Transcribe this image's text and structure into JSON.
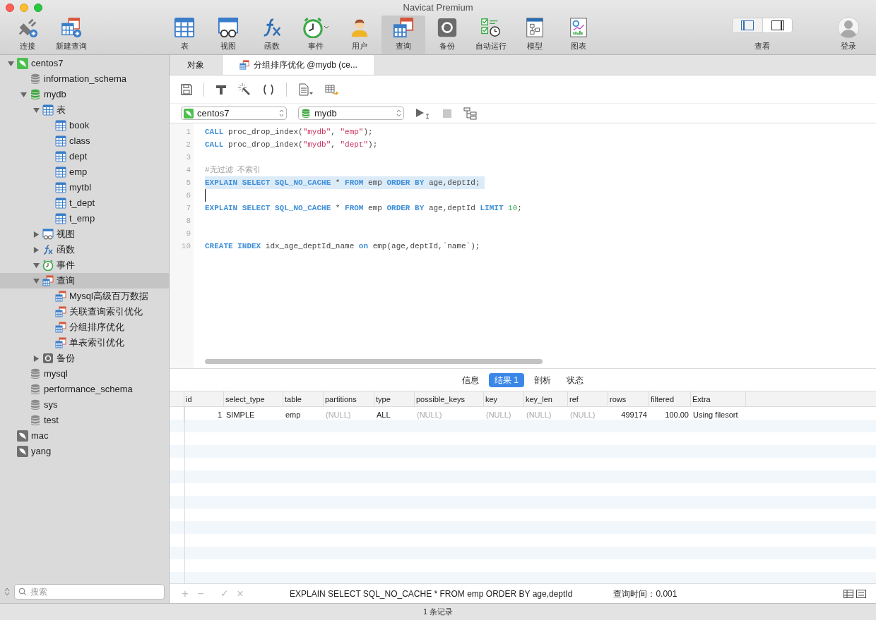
{
  "window": {
    "title": "Navicat Premium"
  },
  "toolbar": {
    "buttons": [
      {
        "label": "连接",
        "kind": "connect",
        "selected": false
      },
      {
        "label": "新建查询",
        "kind": "new_query",
        "selected": false
      },
      {
        "label": "表",
        "kind": "table",
        "selected": false
      },
      {
        "label": "视图",
        "kind": "view",
        "selected": false
      },
      {
        "label": "函数",
        "kind": "function",
        "selected": false
      },
      {
        "label": "事件",
        "kind": "event",
        "selected": false,
        "dropdown": true
      },
      {
        "label": "用户",
        "kind": "user",
        "selected": false
      },
      {
        "label": "查询",
        "kind": "query",
        "selected": true
      },
      {
        "label": "备份",
        "kind": "backup",
        "selected": false
      },
      {
        "label": "自动运行",
        "kind": "schedule",
        "selected": false
      },
      {
        "label": "模型",
        "kind": "model",
        "selected": false
      },
      {
        "label": "图表",
        "kind": "chart",
        "selected": false
      }
    ],
    "view": {
      "label": "查看",
      "toggles": [
        {
          "kind": "left_panel",
          "selected": true
        },
        {
          "kind": "right_panel",
          "selected": false
        }
      ]
    },
    "login": {
      "label": "登录"
    }
  },
  "sidebar": {
    "tree": [
      {
        "label": "centos7",
        "kind": "server",
        "expanded": true,
        "selected": false,
        "children": [
          {
            "label": "information_schema",
            "kind": "database",
            "selected": false
          },
          {
            "label": "mydb",
            "kind": "database_open",
            "expanded": true,
            "selected": false,
            "children": [
              {
                "label": "表",
                "kind": "table",
                "expanded": true,
                "selected": false,
                "children": [
                  {
                    "label": "book",
                    "kind": "table",
                    "selected": false
                  },
                  {
                    "label": "class",
                    "kind": "table",
                    "selected": false
                  },
                  {
                    "label": "dept",
                    "kind": "table",
                    "selected": false
                  },
                  {
                    "label": "emp",
                    "kind": "table",
                    "selected": false
                  },
                  {
                    "label": "mytbl",
                    "kind": "table",
                    "selected": false
                  },
                  {
                    "label": "t_dept",
                    "kind": "table",
                    "selected": false
                  },
                  {
                    "label": "t_emp",
                    "kind": "table",
                    "selected": false
                  }
                ]
              },
              {
                "label": "视图",
                "kind": "view",
                "expanded": false,
                "selected": false
              },
              {
                "label": "函数",
                "kind": "function",
                "expanded": false,
                "selected": false
              },
              {
                "label": "事件",
                "kind": "event",
                "expanded": true,
                "selected": false
              },
              {
                "label": "查询",
                "kind": "query",
                "expanded": true,
                "selected": true,
                "children": [
                  {
                    "label": "Mysql高级百万数据",
                    "kind": "query",
                    "selected": false
                  },
                  {
                    "label": "关联查询索引优化",
                    "kind": "query",
                    "selected": false
                  },
                  {
                    "label": "分组排序优化",
                    "kind": "query",
                    "selected": false
                  },
                  {
                    "label": "单表索引优化",
                    "kind": "query",
                    "selected": false
                  }
                ]
              },
              {
                "label": "备份",
                "kind": "backup",
                "expanded": false,
                "selected": false
              }
            ]
          },
          {
            "label": "mysql",
            "kind": "database",
            "selected": false
          },
          {
            "label": "performance_schema",
            "kind": "database",
            "selected": false
          },
          {
            "label": "sys",
            "kind": "database",
            "selected": false
          },
          {
            "label": "test",
            "kind": "database",
            "selected": false
          }
        ]
      },
      {
        "label": "mac",
        "kind": "server_off",
        "selected": false
      },
      {
        "label": "yang",
        "kind": "server_off",
        "selected": false
      }
    ],
    "search": {
      "placeholder": "搜索"
    }
  },
  "tabs": [
    {
      "label": "对象",
      "selected": false,
      "kind": "objects"
    },
    {
      "label": "分组排序优化 @mydb (ce...",
      "selected": true,
      "kind": "query"
    }
  ],
  "selectors": {
    "connection": "centos7",
    "database": "mydb"
  },
  "editor": {
    "lines": [
      {
        "number": "1",
        "tokens": [
          {
            "kind": "keyword",
            "text": "CALL"
          },
          {
            "kind": "plain",
            "text": " proc_drop_index("
          },
          {
            "kind": "string",
            "text": "\"mydb\""
          },
          {
            "kind": "plain",
            "text": ", "
          },
          {
            "kind": "string",
            "text": "\"emp\""
          },
          {
            "kind": "plain",
            "text": ");"
          }
        ]
      },
      {
        "number": "2",
        "tokens": [
          {
            "kind": "keyword",
            "text": "CALL"
          },
          {
            "kind": "plain",
            "text": " proc_drop_index("
          },
          {
            "kind": "string",
            "text": "\"mydb\""
          },
          {
            "kind": "plain",
            "text": ", "
          },
          {
            "kind": "string",
            "text": "\"dept\""
          },
          {
            "kind": "plain",
            "text": ");"
          }
        ]
      },
      {
        "number": "3"
      },
      {
        "number": "4",
        "tokens": [
          {
            "kind": "comment",
            "text": "#无过滤 不索引"
          }
        ]
      },
      {
        "number": "5",
        "highlighted": true,
        "tokens": [
          {
            "kind": "keyword",
            "text": "EXPLAIN SELECT SQL_NO_CACHE"
          },
          {
            "kind": "plain",
            "text": " * "
          },
          {
            "kind": "keyword",
            "text": "FROM"
          },
          {
            "kind": "plain",
            "text": " emp "
          },
          {
            "kind": "keyword",
            "text": "ORDER BY"
          },
          {
            "kind": "plain",
            "text": " age,deptId;"
          }
        ]
      },
      {
        "number": "6",
        "cursor": true
      },
      {
        "number": "7",
        "tokens": [
          {
            "kind": "keyword",
            "text": "EXPLAIN SELECT SQL_NO_CACHE"
          },
          {
            "kind": "plain",
            "text": " * "
          },
          {
            "kind": "keyword",
            "text": "FROM"
          },
          {
            "kind": "plain",
            "text": " emp "
          },
          {
            "kind": "keyword",
            "text": "ORDER BY"
          },
          {
            "kind": "plain",
            "text": " age,deptId "
          },
          {
            "kind": "keyword",
            "text": "LIMIT"
          },
          {
            "kind": "number",
            "text": " 10"
          },
          {
            "kind": "plain",
            "text": ";"
          }
        ]
      },
      {
        "number": "8"
      },
      {
        "number": "9"
      },
      {
        "number": "10",
        "tokens": [
          {
            "kind": "keyword",
            "text": "CREATE INDEX"
          },
          {
            "kind": "plain",
            "text": " idx_age_deptId_name "
          },
          {
            "kind": "keyword",
            "text": "on"
          },
          {
            "kind": "plain",
            "text": " emp(age,deptId,`name`);"
          }
        ]
      }
    ]
  },
  "result_tabs": [
    {
      "label": "信息",
      "selected": false
    },
    {
      "label": "结果 1",
      "selected": true
    },
    {
      "label": "剖析",
      "selected": false
    },
    {
      "label": "状态",
      "selected": false
    }
  ],
  "table": {
    "columns": [
      "id",
      "select_type",
      "table",
      "partitions",
      "type",
      "possible_keys",
      "key",
      "key_len",
      "ref",
      "rows",
      "filtered",
      "Extra"
    ],
    "rows": [
      [
        {
          "text": "1",
          "kind": "number"
        },
        {
          "text": "SIMPLE",
          "kind": "text"
        },
        {
          "text": "emp",
          "kind": "text"
        },
        {
          "text": "(NULL)",
          "kind": "null"
        },
        {
          "text": "ALL",
          "kind": "text"
        },
        {
          "text": "(NULL)",
          "kind": "null"
        },
        {
          "text": "(NULL)",
          "kind": "null"
        },
        {
          "text": "(NULL)",
          "kind": "null"
        },
        {
          "text": "(NULL)",
          "kind": "null"
        },
        {
          "text": "499174",
          "kind": "number"
        },
        {
          "text": "100.00",
          "kind": "number"
        },
        {
          "text": "Using filesort",
          "kind": "text"
        }
      ]
    ]
  },
  "bottom_bar": {
    "add": "+",
    "remove": "−",
    "apply": "✓",
    "cancel": "×",
    "sql": "EXPLAIN SELECT SQL_NO_CACHE * FROM emp ORDER BY age,deptId",
    "query_time": "查询时间：0.001"
  },
  "status_bar": {
    "text": "1 条记录"
  }
}
